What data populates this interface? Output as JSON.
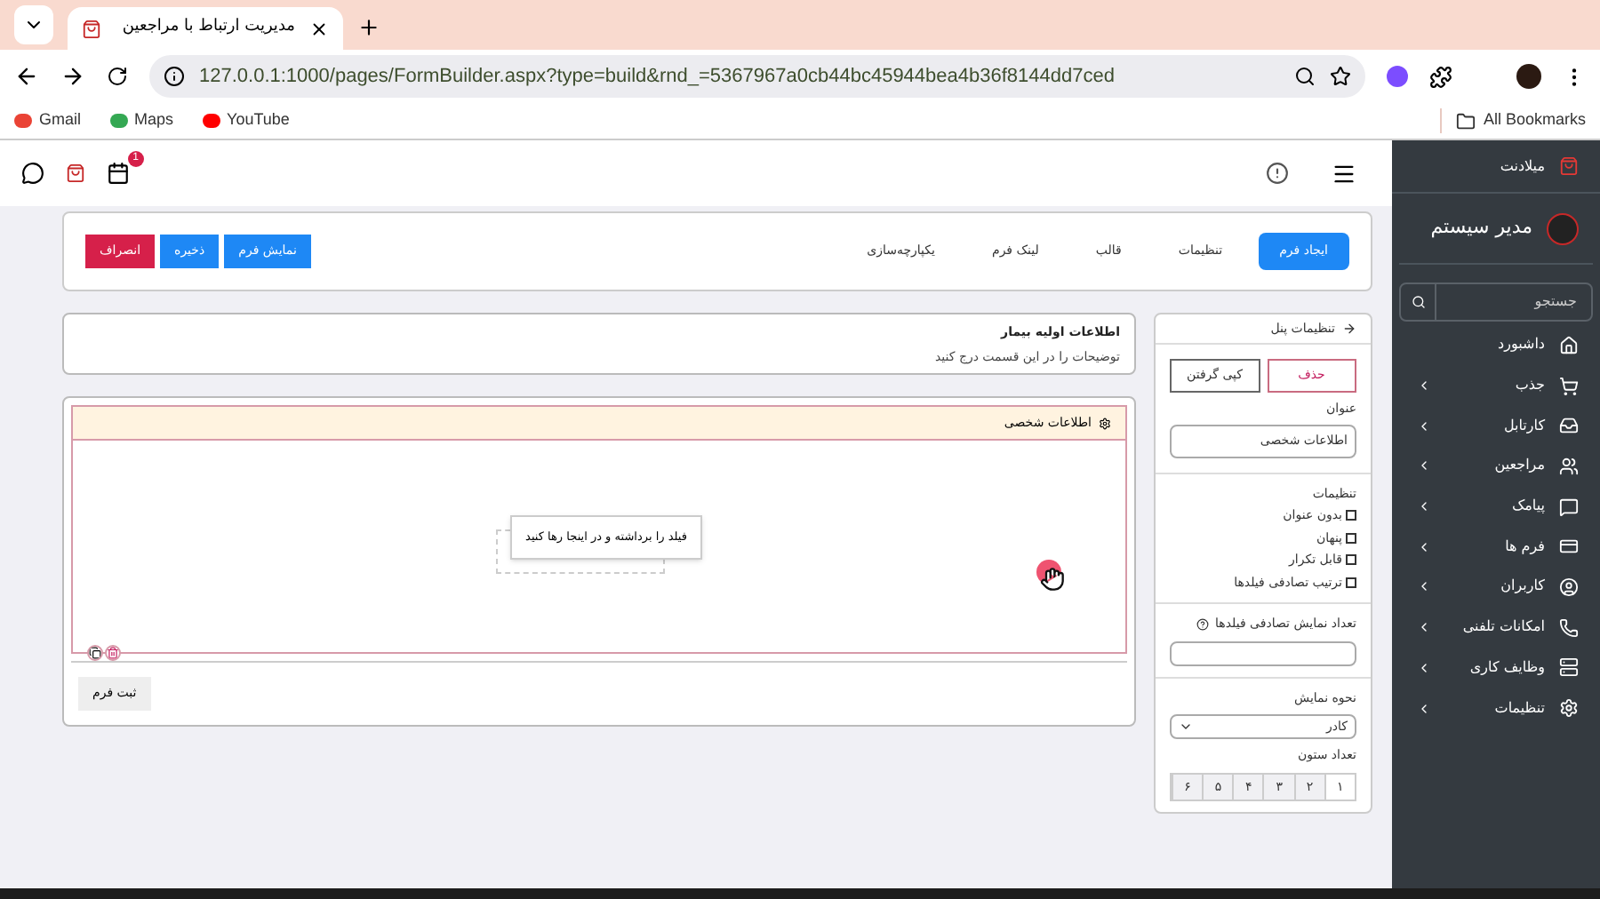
{
  "browser": {
    "tab_title": "مدیریت ارتباط با مراجعین",
    "url": "127.0.0.1:1000/pages/FormBuilder.aspx?type=build&rnd_=5367967a0cb44bc45944bea4b36f8144dd7ced",
    "bookmarks": {
      "first": "Gmail",
      "second": "Maps",
      "third": "YouTube"
    },
    "all_bookmarks": "All Bookmarks"
  },
  "header": {
    "notification_count": "1"
  },
  "toolbar": {
    "tabs": [
      {
        "label": "ایجاد فرم",
        "selected": true
      },
      {
        "label": "تنظیمات",
        "selected": false
      },
      {
        "label": "قالب",
        "selected": false
      },
      {
        "label": "لینک فرم",
        "selected": false
      },
      {
        "label": "یکپارچه‌سازی",
        "selected": false
      }
    ],
    "buttons": [
      {
        "label": "نمایش فرم",
        "kind": "primary"
      },
      {
        "label": "ذخیره",
        "kind": "primary"
      },
      {
        "label": "انصراف",
        "kind": "danger"
      }
    ]
  },
  "form_info": {
    "title": "اطلاعات اولیه بیمار",
    "description": "توضیحات را در این قسمت درج کنید"
  },
  "panel": {
    "title": "اطلاعات شخصی",
    "drop_hint": "فیلد را برداشته و در اینجا رها کنید",
    "submit": "ثبت فرم"
  },
  "settings": {
    "title": "تنظیمات پنل",
    "delete": "حذف",
    "copy": "کپی گرفتن",
    "name_label": "عنوان",
    "name_value": "اطلاعات شخصی",
    "options_label": "تنظیمات",
    "options": [
      {
        "label": "بدون عنوان",
        "checked": false
      },
      {
        "label": "پنهان",
        "checked": false
      },
      {
        "label": "قابل تکرار",
        "checked": false
      },
      {
        "label": "ترتیب تصادفی فیلدها",
        "checked": false
      }
    ],
    "random_count_label": "تعداد نمایش تصادفی فیلدها",
    "display_label": "نحوه نمایش",
    "display_value": "کادر",
    "columns_label": "تعداد ستون",
    "columns": [
      {
        "label": "۱",
        "selected": true
      },
      {
        "label": "۲",
        "selected": false
      },
      {
        "label": "۳",
        "selected": false
      },
      {
        "label": "۴",
        "selected": false
      },
      {
        "label": "۵",
        "selected": false
      },
      {
        "label": "۶",
        "selected": false
      }
    ]
  },
  "sidebar": {
    "brand": "میلادنت",
    "user": "مدیر سیستم",
    "search_placeholder": "جستجو",
    "items": [
      {
        "label": "داشبورد",
        "has_children": false
      },
      {
        "label": "جذب",
        "has_children": true
      },
      {
        "label": "کارتابل",
        "has_children": true
      },
      {
        "label": "مراجعین",
        "has_children": true
      },
      {
        "label": "پیامک",
        "has_children": true
      },
      {
        "label": "فرم ها",
        "has_children": true
      },
      {
        "label": "کاربران",
        "has_children": true
      },
      {
        "label": "امکانات تلفنی",
        "has_children": true
      },
      {
        "label": "وظایف کاری",
        "has_children": true
      },
      {
        "label": "تنظیمات",
        "has_children": true
      }
    ]
  }
}
